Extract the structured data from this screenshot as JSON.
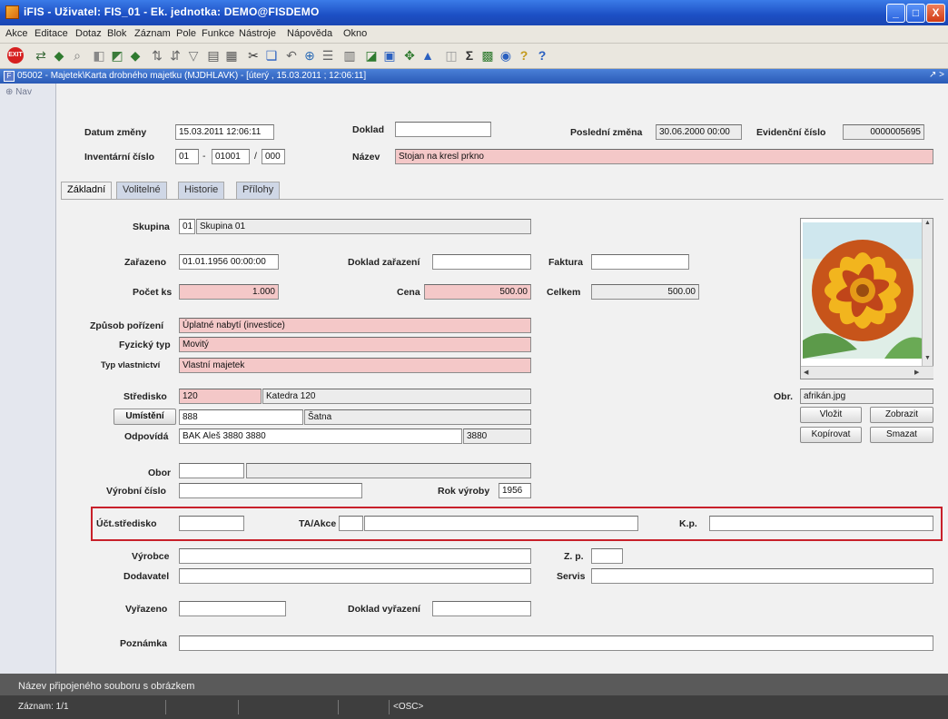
{
  "window": {
    "title": "iFIS - Uživatel: FIS_01 - Ek. jednotka: DEMO@FISDEMO",
    "minimize": "_",
    "maximize": "□",
    "close": "X"
  },
  "menu": [
    "Akce",
    "Editace",
    "Dotaz",
    "Blok",
    "Záznam",
    "Pole",
    "Funkce",
    "Nástroje",
    "Nápověda",
    "Okno"
  ],
  "toolbar": {
    "exit_label": "EXIT"
  },
  "document": {
    "title": "05002 - Majetek\\Karta drobného majetku (MJDHLAVK) - [úterý , 15.03.2011 ; 12:06:11]",
    "resize": "↗ >"
  },
  "nav": {
    "label": "Nav"
  },
  "header": {
    "datum_zmeny_label": "Datum změny",
    "datum_zmeny": "15.03.2011 12:06:11",
    "doklad_label": "Doklad",
    "doklad": "",
    "posledni_zmena_label": "Poslední změna",
    "posledni_zmena": "30.06.2000 00:00",
    "evidencni_cislo_label": "Evidenční číslo",
    "evidencni_cislo": "0000005695",
    "inventarni_cislo_label": "Inventární číslo",
    "inv_1": "01",
    "inv_sep1": "-",
    "inv_2": "01001",
    "inv_sep2": "/",
    "inv_3": "000",
    "nazev_label": "Název",
    "nazev": "Stojan na kresl prkno"
  },
  "tabs": [
    "Základní",
    "Volitelné",
    "Historie",
    "Přílohy"
  ],
  "form": {
    "skupina_label": "Skupina",
    "skupina_code": "01",
    "skupina_name": "Skupina 01",
    "zarazeno_label": "Zařazeno",
    "zarazeno": "01.01.1956 00:00:00",
    "doklad_zarazeni_label": "Doklad zařazení",
    "doklad_zarazeni": "",
    "faktura_label": "Faktura",
    "faktura": "",
    "pocet_ks_label": "Počet ks",
    "pocet_ks": "1.000",
    "cena_label": "Cena",
    "cena": "500.00",
    "celkem_label": "Celkem",
    "celkem": "500.00",
    "zpusob_porizeni_label": "Způsob pořízení",
    "zpusob_porizeni": "Úplatné nabytí (investice)",
    "fyzicky_typ_label": "Fyzický typ",
    "fyzicky_typ": "Movitý",
    "typ_vlastnictvi_label": "Typ vlastnictví",
    "typ_vlastnictvi": "Vlastní majetek",
    "stredisko_label": "Středisko",
    "stredisko_code": "120",
    "stredisko_name": "Katedra 120",
    "umisteni_button": "Umístění",
    "umisteni_code": "888",
    "umisteni_name": "Šatna",
    "odpovida_label": "Odpovídá",
    "odpovida_name": "BAK Aleš 3880 3880",
    "odpovida_code": "3880",
    "obor_label": "Obor",
    "obor_code": "",
    "obor_name": "",
    "vyrobni_cislo_label": "Výrobní číslo",
    "vyrobni_cislo": "",
    "rok_vyroby_label": "Rok výroby",
    "rok_vyroby": "1956",
    "uct_stredisko_label": "Účt.středisko",
    "uct_stredisko": "",
    "ta_akce_label": "TA/Akce",
    "ta_akce_code": "",
    "ta_akce_name": "",
    "kp_label": "K.p.",
    "kp": "",
    "vyrobce_label": "Výrobce",
    "vyrobce": "",
    "zp_label": "Z. p.",
    "zp": "",
    "dodavatel_label": "Dodavatel",
    "dodavatel": "",
    "servis_label": "Servis",
    "servis": "",
    "vyrazeno_label": "Vyřazeno",
    "vyrazeno": "",
    "doklad_vyrazeni_label": "Doklad vyřazení",
    "doklad_vyrazeni": "",
    "poznamka_label": "Poznámka",
    "poznamka": ""
  },
  "image_panel": {
    "obr_label": "Obr.",
    "filename": "afrikán.jpg",
    "vlozit": "Vložit",
    "zobrazit": "Zobrazit",
    "kopirovat": "Kopírovat",
    "smazat": "Smazat"
  },
  "status": {
    "message": "Název připojeného souboru s obrázkem",
    "record": "Záznam: 1/1",
    "mode": "<OSC>"
  },
  "colors": {
    "required_field": "#f4c8c8",
    "highlight_border": "#c8202a",
    "titlebar": "#1c4fc4"
  }
}
